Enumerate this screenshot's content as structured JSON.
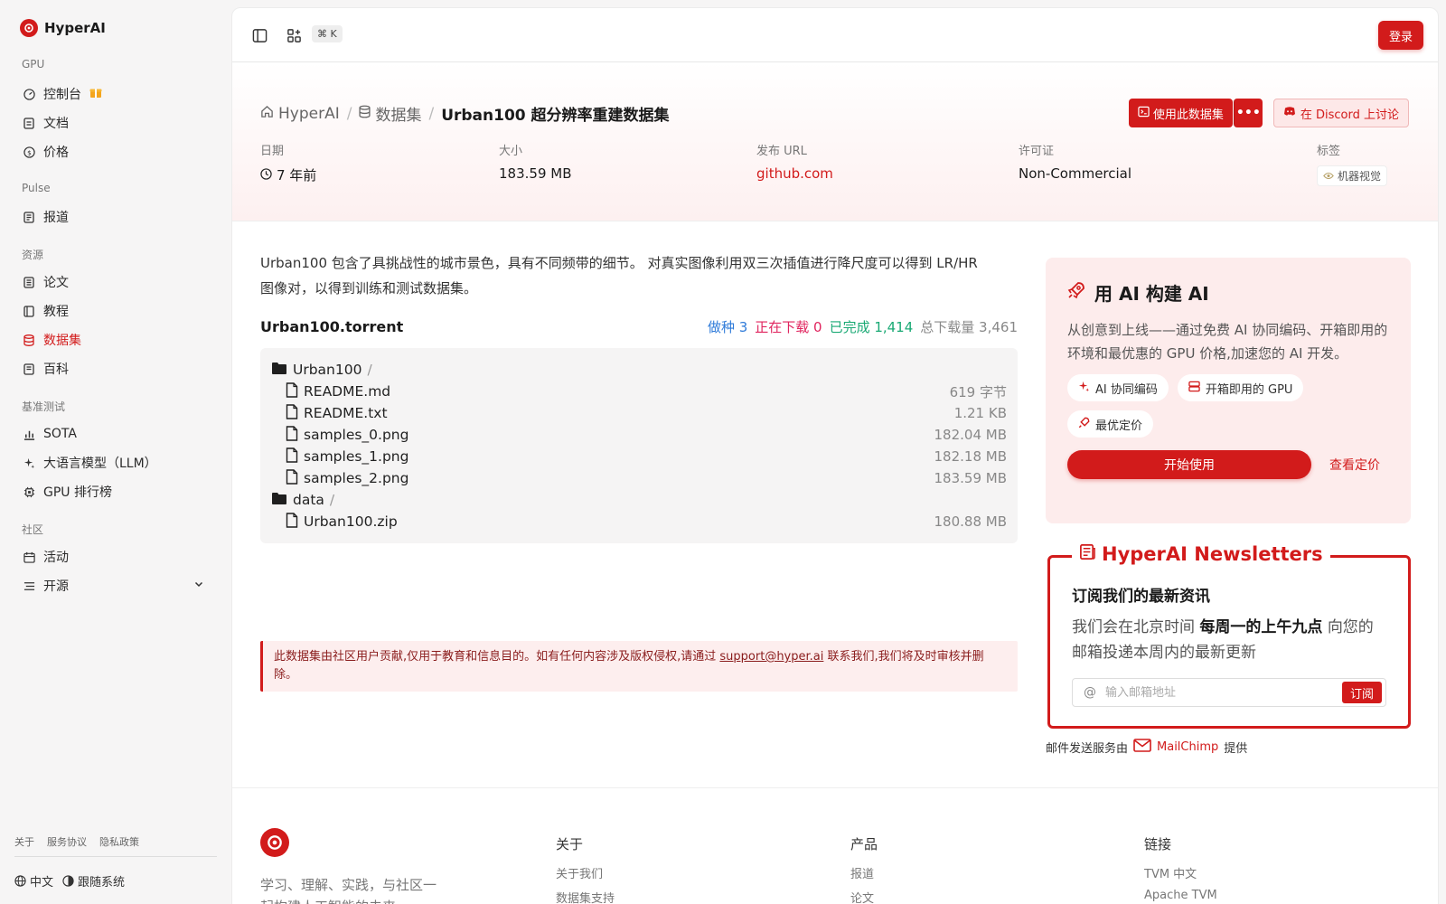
{
  "brand": {
    "name": "HyperAI",
    "accent": "#d21b1b"
  },
  "sidebar": {
    "sections": [
      {
        "label": "GPU",
        "items": [
          {
            "label": "控制台",
            "icon": "gauge-icon",
            "badge": "gift"
          },
          {
            "label": "文档",
            "icon": "doc-icon"
          },
          {
            "label": "价格",
            "icon": "dollar-icon"
          }
        ]
      },
      {
        "label": "Pulse",
        "items": [
          {
            "label": "报道",
            "icon": "news-icon"
          }
        ]
      },
      {
        "label": "资源",
        "items": [
          {
            "label": "论文",
            "icon": "paper-icon"
          },
          {
            "label": "教程",
            "icon": "book-icon"
          },
          {
            "label": "数据集",
            "icon": "database-icon",
            "active": true
          },
          {
            "label": "百科",
            "icon": "wiki-icon"
          }
        ]
      },
      {
        "label": "基准测试",
        "items": [
          {
            "label": "SOTA",
            "icon": "chart-icon"
          },
          {
            "label": "大语言模型（LLM）",
            "icon": "sparkle-icon"
          },
          {
            "label": "GPU 排行榜",
            "icon": "chip-icon"
          }
        ]
      },
      {
        "label": "社区",
        "items": [
          {
            "label": "活动",
            "icon": "calendar-icon"
          },
          {
            "label": "开源",
            "icon": "list-icon",
            "expandable": true
          }
        ]
      }
    ],
    "footer_links": [
      "关于",
      "服务协议",
      "隐私政策"
    ],
    "language": "中文",
    "theme": "跟随系统"
  },
  "topbar": {
    "shortcut": "⌘ K",
    "login": "登录"
  },
  "breadcrumb": {
    "home": "HyperAI",
    "section": "数据集",
    "current": "Urban100 超分辨率重建数据集"
  },
  "actions": {
    "use": "使用此数据集",
    "more": "•••",
    "discord": "在 Discord 上讨论"
  },
  "meta": {
    "date_label": "日期",
    "date_value": "7 年前",
    "size_label": "大小",
    "size_value": "183.59 MB",
    "url_label": "发布 URL",
    "url_value": "github.com",
    "license_label": "许可证",
    "license_value": "Non-Commercial",
    "tags_label": "标签",
    "tag": "机器视觉"
  },
  "description": "Urban100 包含了具挑战性的城市景色，具有不同频带的细节。 对真实图像利用双三次插值进行降尺度可以得到 LR/HR 图像对，以得到训练和测试数据集。",
  "torrent": {
    "name": "Urban100.torrent",
    "seeding": "做种 3",
    "downloading": "正在下载 0",
    "completed": "已完成 1,414",
    "total": "总下载量 3,461",
    "files": [
      {
        "name": "Urban100",
        "type": "folder",
        "size": ""
      },
      {
        "name": "README.md",
        "type": "file",
        "size": "619 字节"
      },
      {
        "name": "README.txt",
        "type": "file",
        "size": "1.21 KB"
      },
      {
        "name": "samples_0.png",
        "type": "file",
        "size": "182.04 MB"
      },
      {
        "name": "samples_1.png",
        "type": "file",
        "size": "182.18 MB"
      },
      {
        "name": "samples_2.png",
        "type": "file",
        "size": "183.59 MB"
      },
      {
        "name": "data",
        "type": "folder",
        "size": ""
      },
      {
        "name": "Urban100.zip",
        "type": "file",
        "size": "180.88 MB"
      }
    ]
  },
  "notice": {
    "text_before": "此数据集由社区用户贡献,仅用于教育和信息目的。如有任何内容涉及版权侵权,请通过",
    "email": "support@hyper.ai",
    "text_after": "联系我们,我们将及时审核并删除。"
  },
  "cta": {
    "title": "用 AI 构建 AI",
    "desc": "从创意到上线——通过免费 AI 协同编码、开箱即用的环境和最优惠的 GPU 价格,加速您的 AI 开发。",
    "chips": [
      "AI 协同编码",
      "开箱即用的 GPU",
      "最优定价"
    ],
    "start": "开始使用",
    "pricing": "查看定价"
  },
  "newsletter": {
    "title": "HyperAI Newsletters",
    "subtitle": "订阅我们的最新资讯",
    "desc_before": "我们会在北京时间",
    "desc_bold": "每周一的上午九点",
    "desc_after": "向您的邮箱投递本周内的最新更新",
    "placeholder": "输入邮箱地址",
    "button": "订阅",
    "credit_before": "邮件发送服务由",
    "credit_brand": "MailChimp",
    "credit_after": "提供"
  },
  "footer": {
    "tagline": "学习、理解、实践，与社区一起构建人工智能的未来",
    "col_about": {
      "title": "关于",
      "items": [
        "关于我们",
        "数据集支持"
      ]
    },
    "col_products": {
      "title": "产品",
      "items": [
        "报道",
        "论文"
      ]
    },
    "col_links": {
      "title": "链接",
      "items": [
        "TVM 中文",
        "Apache TVM"
      ]
    }
  }
}
